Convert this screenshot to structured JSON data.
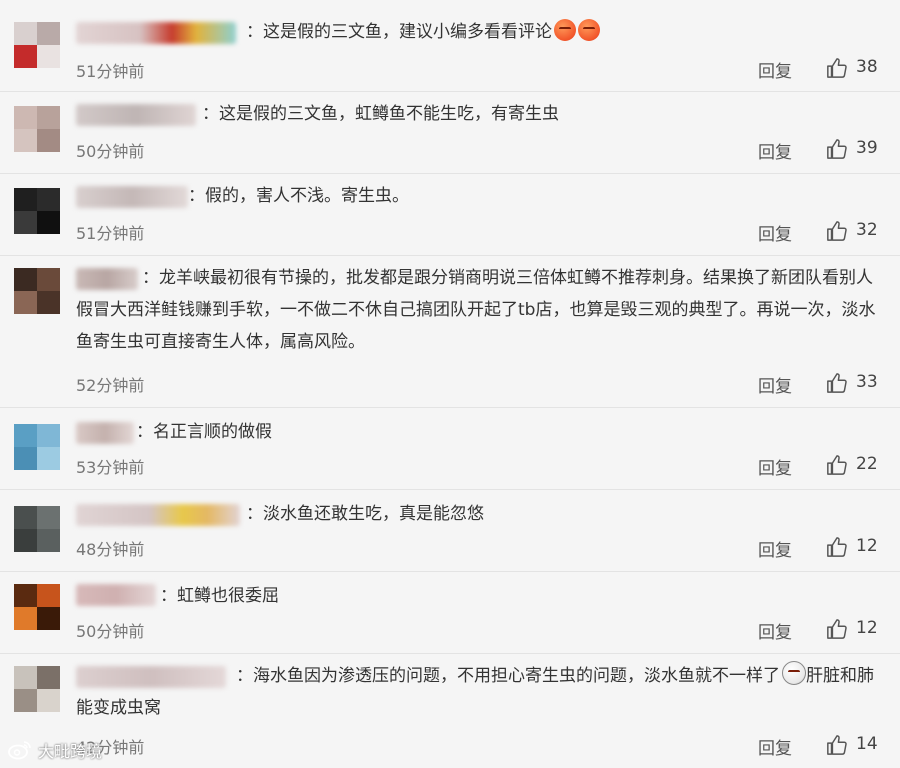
{
  "comments": [
    {
      "text": "：这是假的三文鱼，建议小编多看看评论",
      "emojis": [
        "angry-emoji",
        "angry-emoji"
      ],
      "time": "51分钟前",
      "reply": "回复",
      "likes": "38"
    },
    {
      "text": "：这是假的三文鱼，虹鳟鱼不能生吃，有寄生虫",
      "time": "50分钟前",
      "reply": "回复",
      "likes": "39"
    },
    {
      "text": "：假的，害人不浅。寄生虫。",
      "time": "51分钟前",
      "reply": "回复",
      "likes": "32"
    },
    {
      "text": "：龙羊峡最初很有节操的，批发都是跟分销商明说三倍体虹鳟不推荐刺身。结果换了新团队看别人假冒大西洋鲑钱赚到手软，一不做二不休自己搞团队开起了tb店，也算是毁三观的典型了。再说一次，淡水鱼寄生虫可直接寄生人体，属高风险。",
      "time": "52分钟前",
      "reply": "回复",
      "likes": "33"
    },
    {
      "text": "：名正言顺的做假",
      "time": "53分钟前",
      "reply": "回复",
      "likes": "22"
    },
    {
      "text": "：淡水鱼还敢生吃，真是能忽悠",
      "time": "48分钟前",
      "reply": "回复",
      "likes": "12"
    },
    {
      "text": "：虹鳟也很委屈",
      "time": "50分钟前",
      "reply": "回复",
      "likes": "12"
    },
    {
      "text": "：海水鱼因为渗透压的问题，不用担心寄生虫的问题，淡水鱼就不一样了",
      "text_after_emoji": "肝脏和肺能变成虫窝",
      "time": "42分钟前",
      "reply": "回复",
      "likes": "14"
    }
  ],
  "watermark": {
    "text": "大毗跨境",
    "icon": "weibo-logo-icon"
  },
  "icons": {
    "like": "thumbs-up-icon"
  },
  "colors": {
    "background": "#f5f5f5",
    "divider": "#e3e3e3",
    "text": "#333333",
    "muted": "#777777"
  }
}
